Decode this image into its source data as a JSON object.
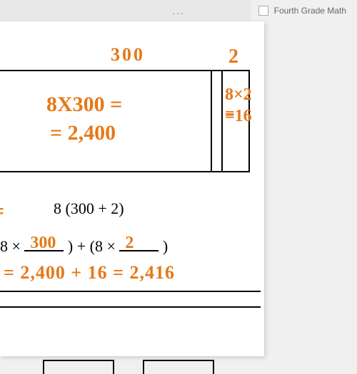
{
  "toolbar": {
    "ellipsis": "...",
    "tab_label": "Fourth Grade Math"
  },
  "handwritten": {
    "top_300": "300",
    "top_2": "2",
    "expr_8x300": "8X300 =",
    "expr_2400": "= 2,400",
    "expr_8x2": "8×2 =",
    "expr_16": "=16",
    "equals_left": "=",
    "bottom_open": "=",
    "fill_300": "300",
    "fill_2": "2",
    "sum_line": "= 2,400 + 16 = 2,416"
  },
  "printed": {
    "distributive": "8 (300 + 2)",
    "bottom_prefix": "8 × ",
    "bottom_mid": " ) + (8 × ",
    "bottom_suffix": " )"
  }
}
